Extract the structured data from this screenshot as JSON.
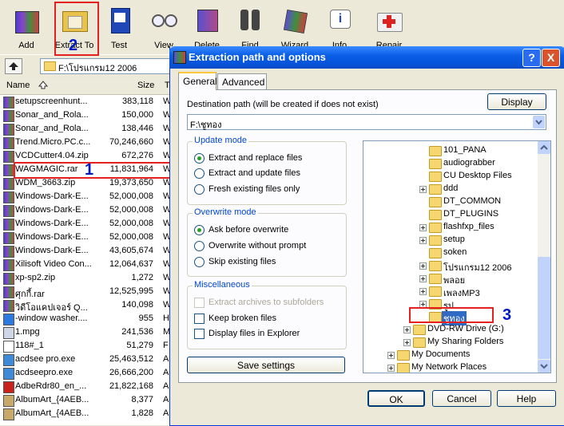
{
  "toolbar": {
    "buttons": [
      {
        "label": "Add",
        "icon": "add-archive-icon"
      },
      {
        "label": "Extract To",
        "icon": "extract-to-icon"
      },
      {
        "label": "Test",
        "icon": "test-icon"
      },
      {
        "label": "View",
        "icon": "view-glasses-icon"
      },
      {
        "label": "Delete",
        "icon": "delete-icon"
      },
      {
        "label": "Find",
        "icon": "find-binoculars-icon"
      },
      {
        "label": "Wizard",
        "icon": "wizard-icon"
      },
      {
        "label": "Info",
        "icon": "info-icon"
      },
      {
        "label": "Repair",
        "icon": "repair-kit-icon"
      }
    ]
  },
  "address": {
    "path": "F:\\โปรแกรม12 2006"
  },
  "columns": {
    "name": "Name",
    "size": "Size",
    "type": "T"
  },
  "files": [
    {
      "name": "setupscreenhunt...",
      "size": "383,118",
      "type": "W",
      "icon": "rar"
    },
    {
      "name": "Sonar_and_Rola...",
      "size": "150,000",
      "type": "W",
      "icon": "rar"
    },
    {
      "name": "Sonar_and_Rola...",
      "size": "138,446",
      "type": "W",
      "icon": "rar"
    },
    {
      "name": "Trend.Micro.PC.c...",
      "size": "70,246,660",
      "type": "W",
      "icon": "rar"
    },
    {
      "name": "VCDCutter4.04.zip",
      "size": "672,276",
      "type": "W",
      "icon": "rar"
    },
    {
      "name": "WAGMAGIC.rar",
      "size": "11,831,964",
      "type": "W",
      "icon": "rar"
    },
    {
      "name": "WDM_3663.zip",
      "size": "19,373,650",
      "type": "W",
      "icon": "rar"
    },
    {
      "name": "Windows-Dark-E...",
      "size": "52,000,008",
      "type": "W",
      "icon": "rar"
    },
    {
      "name": "Windows-Dark-E...",
      "size": "52,000,008",
      "type": "W",
      "icon": "rar"
    },
    {
      "name": "Windows-Dark-E...",
      "size": "52,000,008",
      "type": "W",
      "icon": "rar"
    },
    {
      "name": "Windows-Dark-E...",
      "size": "52,000,008",
      "type": "W",
      "icon": "rar"
    },
    {
      "name": "Windows-Dark-E...",
      "size": "43,605,674",
      "type": "W",
      "icon": "rar"
    },
    {
      "name": "Xilisoft Video Con...",
      "size": "12,064,637",
      "type": "W",
      "icon": "rar"
    },
    {
      "name": "xp-sp2.zip",
      "size": "1,272",
      "type": "W",
      "icon": "rar"
    },
    {
      "name": "ศุกกี้.rar",
      "size": "12,525,995",
      "type": "W",
      "icon": "rar"
    },
    {
      "name": "วิดีโอแคปเจอร์ Q...",
      "size": "140,098",
      "type": "W",
      "icon": "rar"
    },
    {
      "name": "-window washer....",
      "size": "955",
      "type": "H",
      "icon": "ie"
    },
    {
      "name": "1.mpg",
      "size": "241,536",
      "type": "M",
      "icon": "media"
    },
    {
      "name": "118#_1",
      "size": "51,279",
      "type": "F",
      "icon": "file"
    },
    {
      "name": "acdsee pro.exe",
      "size": "25,463,512",
      "type": "A",
      "icon": "exe"
    },
    {
      "name": "acdseepro.exe",
      "size": "26,666,200",
      "type": "A",
      "icon": "exe"
    },
    {
      "name": "AdbeRdr80_en_...",
      "size": "21,822,168",
      "type": "A",
      "icon": "pdf"
    },
    {
      "name": "AlbumArt_{4AEB...",
      "size": "8,377",
      "type": "A",
      "icon": "jpg"
    },
    {
      "name": "AlbumArt_{4AEB...",
      "size": "1,828",
      "type": "A",
      "icon": "jpg"
    }
  ],
  "dialog": {
    "title": "Extraction path and options",
    "help_btn": "?",
    "close_btn": "X",
    "tabs": [
      "General",
      "Advanced"
    ],
    "dest_label": "Destination path (will be created if does not exist)",
    "display_btn": "Display",
    "dest_value": "F:\\ชูทอง",
    "update_mode": {
      "caption": "Update mode",
      "options": [
        {
          "label": "Extract and replace files",
          "checked": true
        },
        {
          "label": "Extract and update files",
          "checked": false
        },
        {
          "label": "Fresh existing files only",
          "checked": false
        }
      ]
    },
    "overwrite_mode": {
      "caption": "Overwrite mode",
      "options": [
        {
          "label": "Ask before overwrite",
          "checked": true
        },
        {
          "label": "Overwrite without prompt",
          "checked": false
        },
        {
          "label": "Skip existing files",
          "checked": false
        }
      ]
    },
    "misc": {
      "caption": "Miscellaneous",
      "options": [
        {
          "label": "Extract archives to subfolders",
          "checked": false,
          "disabled": true
        },
        {
          "label": "Keep broken files",
          "checked": false,
          "disabled": false
        },
        {
          "label": "Display files in Explorer",
          "checked": false,
          "disabled": false
        }
      ]
    },
    "save_btn": "Save settings",
    "tree": [
      {
        "label": "101_PANA",
        "expander": ""
      },
      {
        "label": "audiograbber",
        "expander": ""
      },
      {
        "label": "CU Desktop Files",
        "expander": ""
      },
      {
        "label": "ddd",
        "expander": "+"
      },
      {
        "label": "DT_COMMON",
        "expander": ""
      },
      {
        "label": "DT_PLUGINS",
        "expander": ""
      },
      {
        "label": "flashfxp_files",
        "expander": "+"
      },
      {
        "label": "setup",
        "expander": "+"
      },
      {
        "label": "soken",
        "expander": ""
      },
      {
        "label": "โปรแกรม12 2006",
        "expander": "+"
      },
      {
        "label": "พลอย",
        "expander": "+"
      },
      {
        "label": "เพลงMP3",
        "expander": "+"
      },
      {
        "label": "รูป",
        "expander": "+"
      },
      {
        "label": "ชูทอง",
        "expander": "",
        "selected": true
      },
      {
        "label": "DVD-RW Drive (G:)",
        "expander": "+"
      },
      {
        "label": "My Sharing Folders",
        "expander": "+"
      },
      {
        "label": "My Documents",
        "expander": "+"
      },
      {
        "label": "My Network Places",
        "expander": "+"
      }
    ],
    "ok_btn": "OK",
    "cancel_btn": "Cancel",
    "help_label": "Help"
  },
  "annotations": {
    "n1": "1",
    "n2": "2",
    "n3": "3"
  },
  "colors": {
    "title_blue": "#0a5fe7",
    "annotation_red": "#e52020",
    "annotation_blue": "#0018c8",
    "selection": "#316ac5"
  }
}
